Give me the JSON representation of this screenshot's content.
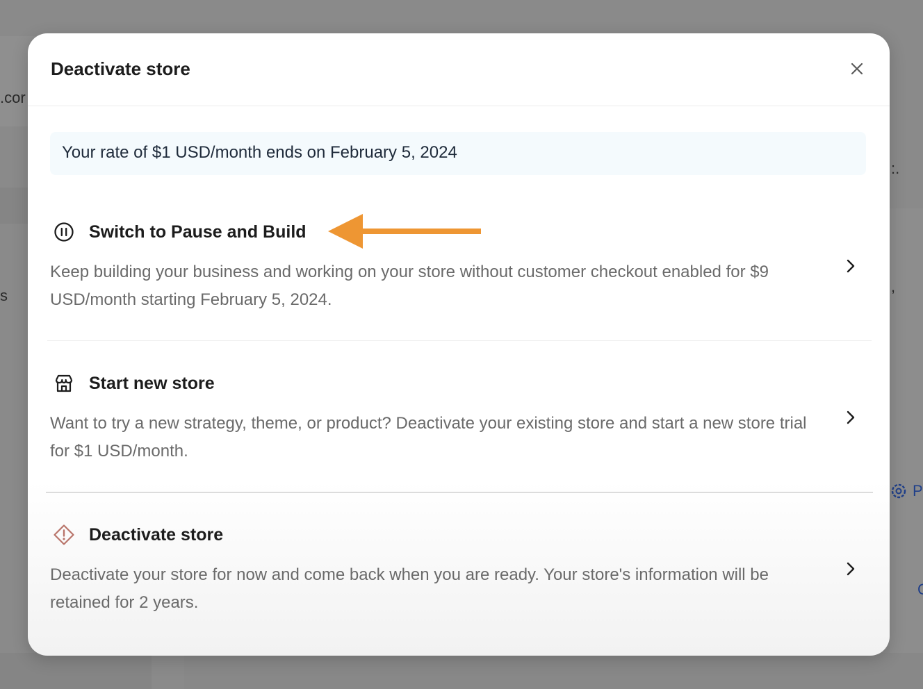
{
  "background": {
    "left_text_1": ".cor",
    "left_text_2": "s",
    "right_text_1": ":.",
    "right_text_2": ",",
    "right_link": "P",
    "right_text_3": "C"
  },
  "modal": {
    "title": "Deactivate store",
    "close_icon": "close-icon",
    "rate_banner": "Your rate of $1 USD/month ends on February 5, 2024",
    "options": [
      {
        "icon": "pause-circle-icon",
        "title": "Switch to Pause and Build",
        "description": "Keep building your business and working on your store without customer checkout enabled for $9 USD/month starting February 5, 2024."
      },
      {
        "icon": "store-icon",
        "title": "Start new store",
        "description": "Want to try a new strategy, theme, or product? Deactivate your existing store and start a new store trial for $1 USD/month."
      },
      {
        "icon": "alert-diamond-icon",
        "title": "Deactivate store",
        "description": "Deactivate your store for now and come back when you are ready. Your store's information will be retained for 2 years."
      }
    ]
  },
  "annotation": {
    "arrow_color": "#ee9633"
  }
}
